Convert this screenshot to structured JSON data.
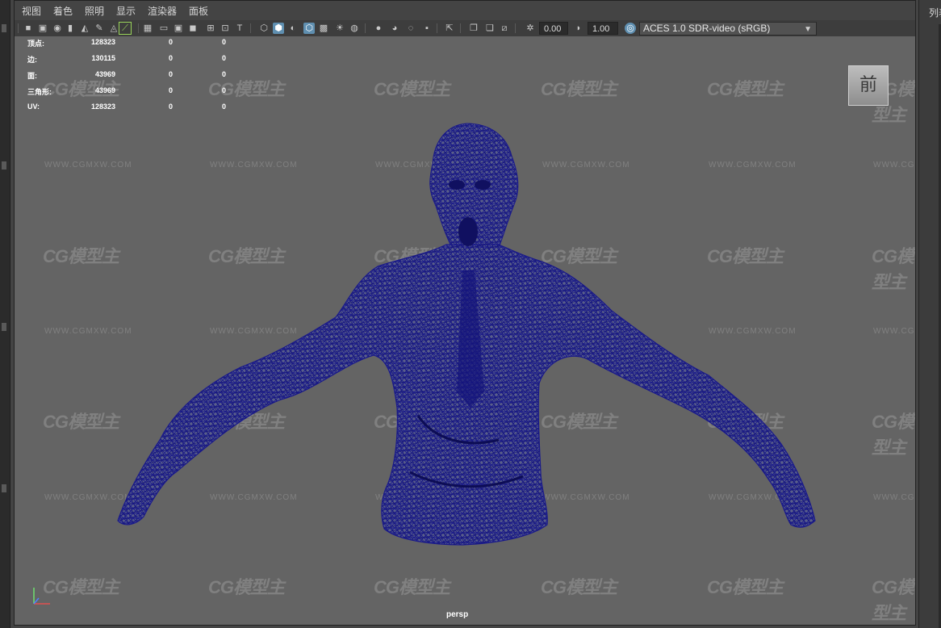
{
  "menu": [
    "视图",
    "着色",
    "照明",
    "显示",
    "渲染器",
    "面板"
  ],
  "toolbar": {
    "exposure_value": "0.00",
    "gamma_value": "1.00",
    "color_space": "ACES 1.0 SDR-video (sRGB)"
  },
  "hud": {
    "rows": [
      {
        "label": "顶点:",
        "total": "128323",
        "selected": "0",
        "sub": "0"
      },
      {
        "label": "边:",
        "total": "130115",
        "selected": "0",
        "sub": "0"
      },
      {
        "label": "面:",
        "total": "43969",
        "selected": "0",
        "sub": "0"
      },
      {
        "label": "三角形:",
        "total": "43969",
        "selected": "0",
        "sub": "0"
      },
      {
        "label": "UV:",
        "total": "128323",
        "selected": "0",
        "sub": "0"
      }
    ]
  },
  "view_cube_face": "前",
  "camera_name": "persp",
  "right_panel_label": "列表",
  "watermark": {
    "logo": "CG模型主",
    "url": "WWW.CGMXW.COM"
  },
  "colors": {
    "viewport_bg": "#646464",
    "wireframe": "#1a1a8c",
    "accent": "#5f8fb0"
  }
}
